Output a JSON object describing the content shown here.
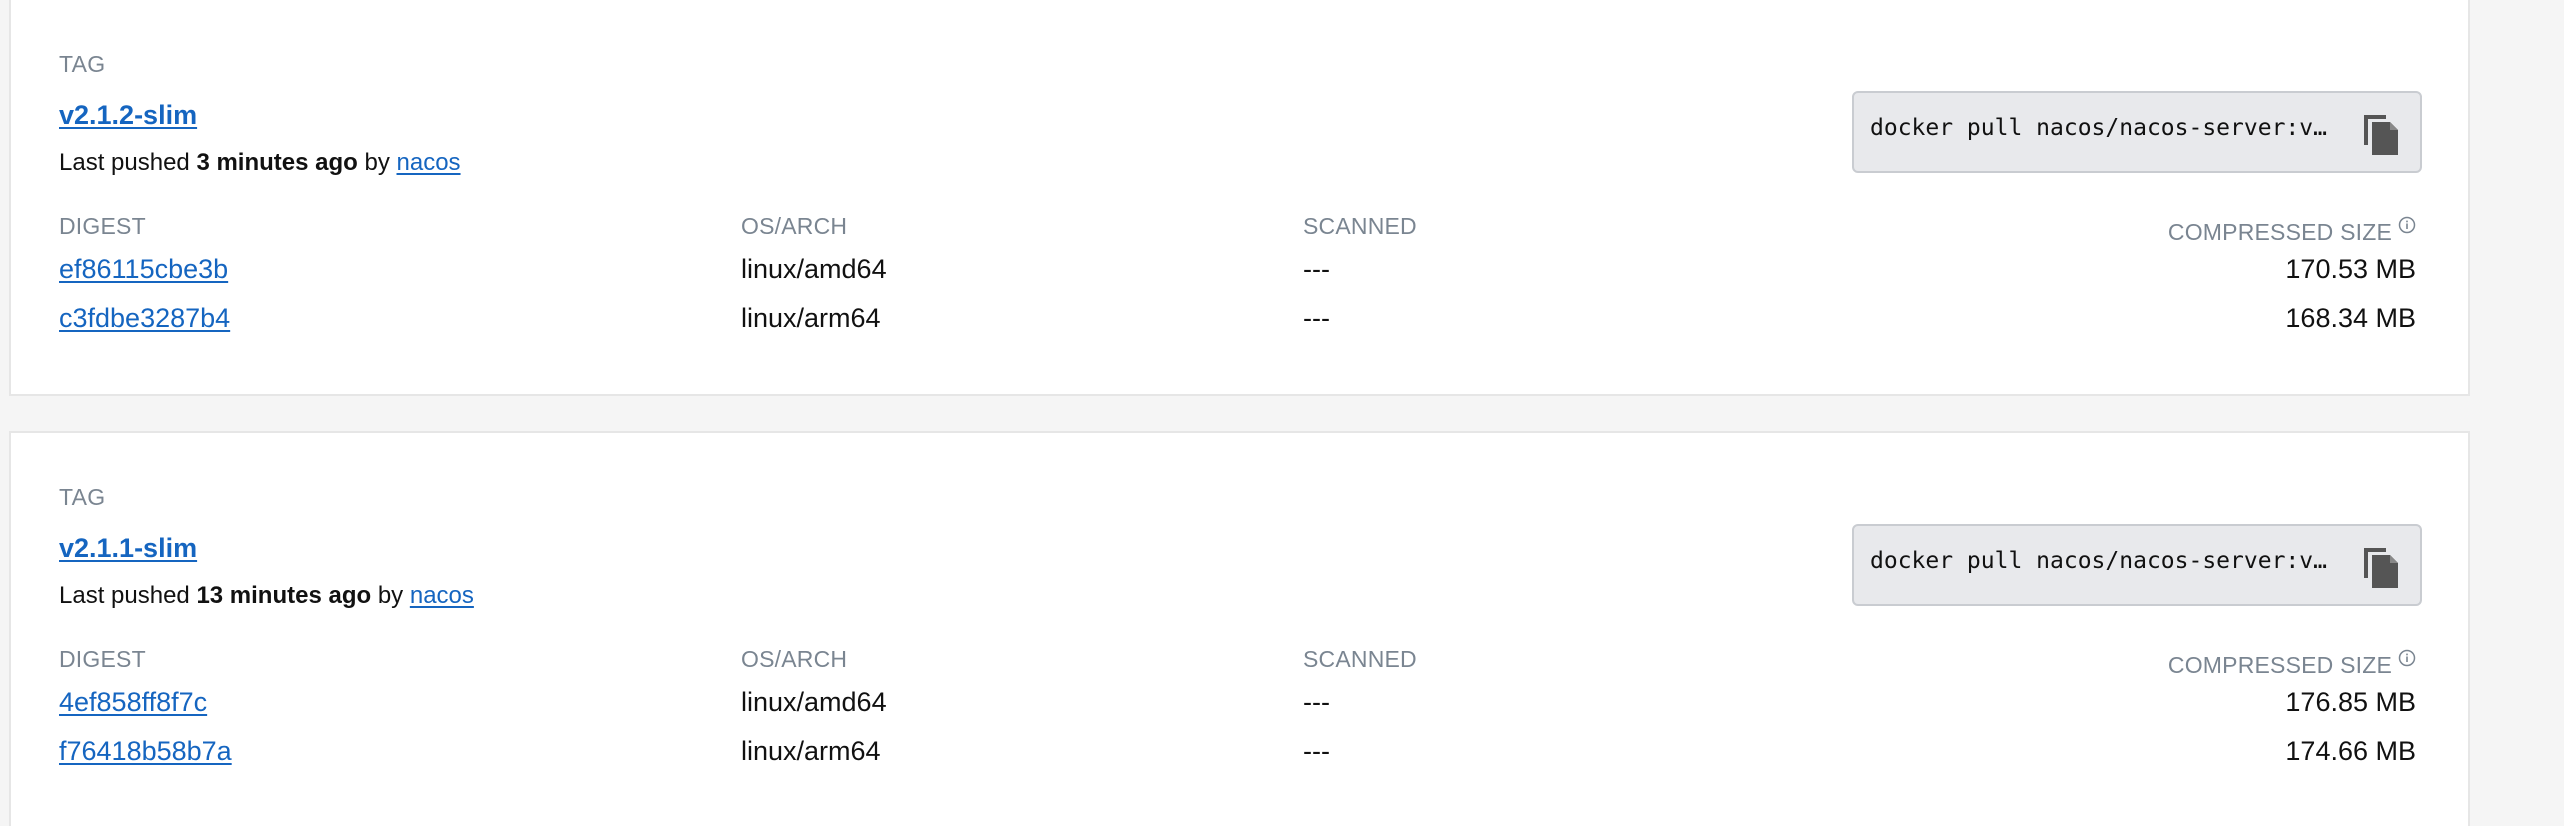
{
  "tags": [
    {
      "section_label": "TAG",
      "name": "v2.1.2-slim",
      "pushed_prefix": "Last pushed ",
      "pushed_time": "3 minutes ago",
      "pushed_by_prefix": " by ",
      "pushed_by": "nacos",
      "pull_command": "docker pull nacos/nacos-server:v…",
      "columns": {
        "digest": "DIGEST",
        "os_arch": "OS/ARCH",
        "scanned": "SCANNED",
        "compressed_size": "COMPRESSED SIZE"
      },
      "rows": [
        {
          "digest": "ef86115cbe3b",
          "os_arch": "linux/amd64",
          "scanned": "---",
          "size": "170.53 MB"
        },
        {
          "digest": "c3fdbe3287b4",
          "os_arch": "linux/arm64",
          "scanned": "---",
          "size": "168.34 MB"
        }
      ]
    },
    {
      "section_label": "TAG",
      "name": "v2.1.1-slim",
      "pushed_prefix": "Last pushed ",
      "pushed_time": "13 minutes ago",
      "pushed_by_prefix": " by ",
      "pushed_by": "nacos",
      "pull_command": "docker pull nacos/nacos-server:v…",
      "columns": {
        "digest": "DIGEST",
        "os_arch": "OS/ARCH",
        "scanned": "SCANNED",
        "compressed_size": "COMPRESSED SIZE"
      },
      "rows": [
        {
          "digest": "4ef858ff8f7c",
          "os_arch": "linux/amd64",
          "scanned": "---",
          "size": "176.85 MB"
        },
        {
          "digest": "f76418b58b7a",
          "os_arch": "linux/arm64",
          "scanned": "---",
          "size": "174.66 MB"
        }
      ]
    }
  ],
  "icons": {
    "copy": "copy-icon",
    "info": "info-icon"
  },
  "colors": {
    "link": "#1565c0",
    "muted": "#7a8591",
    "copy_icon": "#555555"
  }
}
